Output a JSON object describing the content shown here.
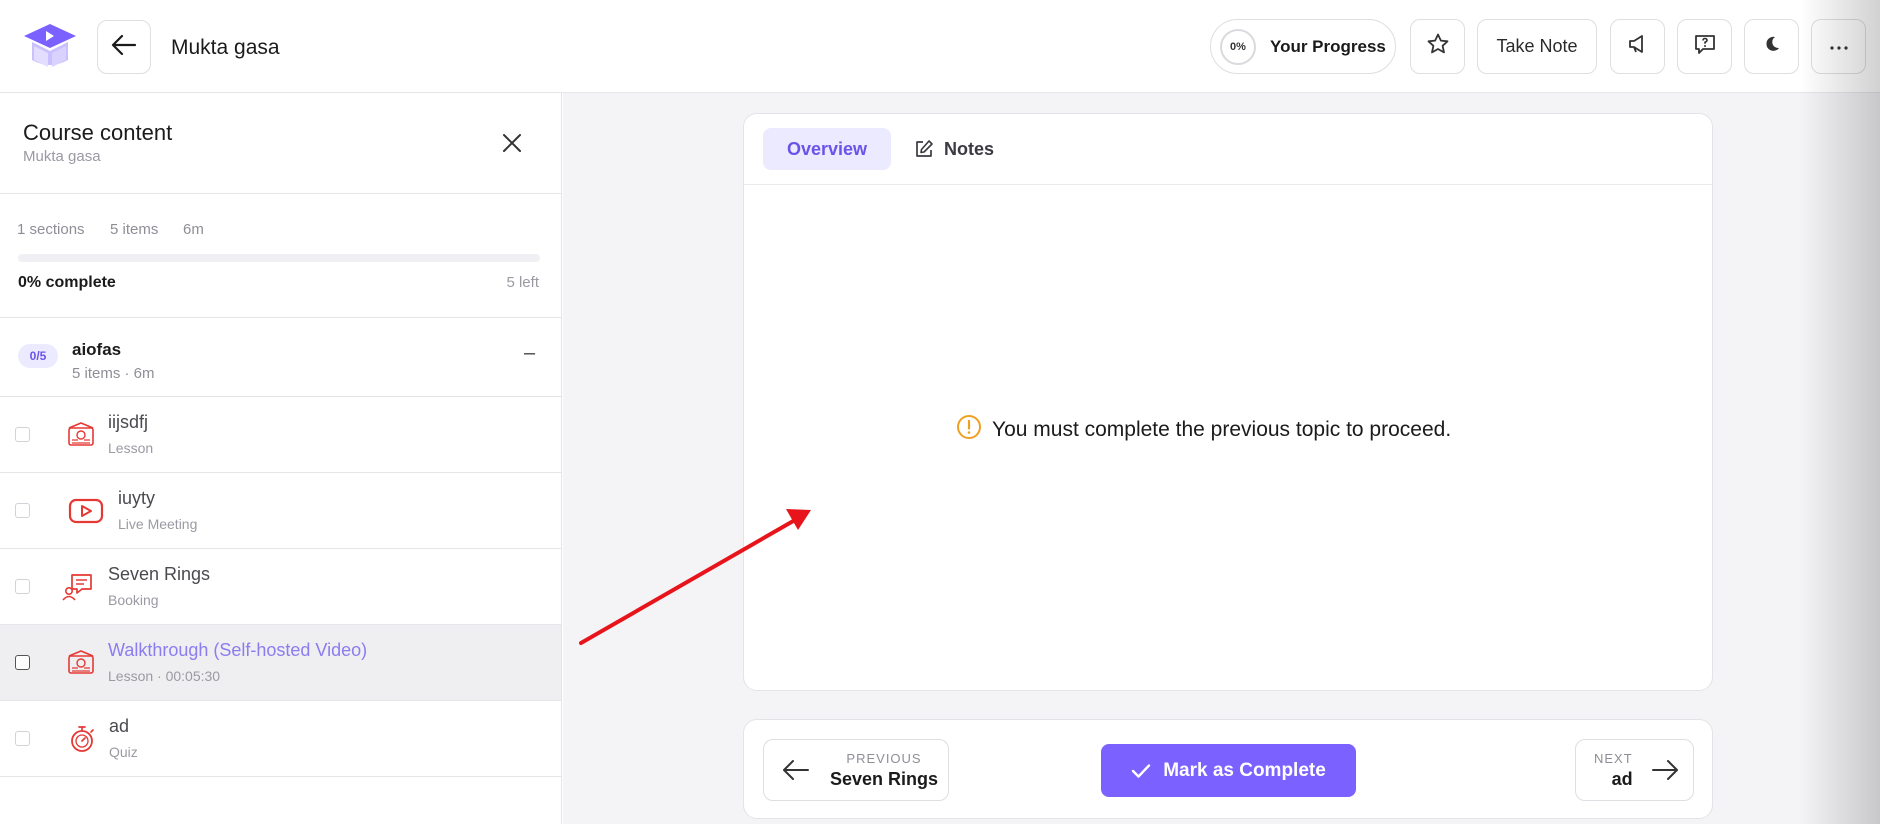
{
  "header": {
    "course_title": "Mukta gasa",
    "progress_percent": "0%",
    "progress_label": "Your Progress",
    "take_note_label": "Take Note",
    "icons": [
      "graduation-cap-logo",
      "arrow-left-icon",
      "star-icon",
      "megaphone-icon",
      "help-chat-icon",
      "moon-icon",
      "more-dots-icon"
    ]
  },
  "sidebar": {
    "title": "Course content",
    "subtitle": "Mukta gasa",
    "stats": {
      "sections": "1 sections",
      "items": "5 items",
      "duration": "6m"
    },
    "progress": {
      "complete_label": "0% complete",
      "left_label": "5 left",
      "fraction": 0
    },
    "section": {
      "badge": "0/5",
      "name": "aiofas",
      "meta": "5 items · 6m",
      "toggle": "–"
    },
    "items": [
      {
        "name": "iijsdfj",
        "type": "Lesson",
        "icon": "lesson-icon",
        "active": false
      },
      {
        "name": "iuyty",
        "type": "Live Meeting",
        "icon": "youtube-play-icon",
        "active": false
      },
      {
        "name": "Seven Rings",
        "type": "Booking",
        "icon": "booking-chat-icon",
        "active": false
      },
      {
        "name": "Walkthrough (Self-hosted Video)",
        "type": "Lesson · 00:05:30",
        "icon": "lesson-icon",
        "active": true
      },
      {
        "name": "ad",
        "type": "Quiz",
        "icon": "quiz-stopwatch-icon",
        "active": false
      }
    ]
  },
  "main": {
    "tabs": {
      "overview": "Overview",
      "notes": "Notes"
    },
    "notice": "You must complete the previous topic to proceed.",
    "nav": {
      "previous_small": "PREVIOUS",
      "previous_title": "Seven Rings",
      "complete_label": "Mark as Complete",
      "next_small": "NEXT",
      "next_title": "ad"
    }
  },
  "colors": {
    "accent": "#7b61ff",
    "accent_soft": "#eceaff",
    "icon_red": "#e53935",
    "warning": "#f0a020",
    "annotation_arrow": "#e8141b"
  }
}
